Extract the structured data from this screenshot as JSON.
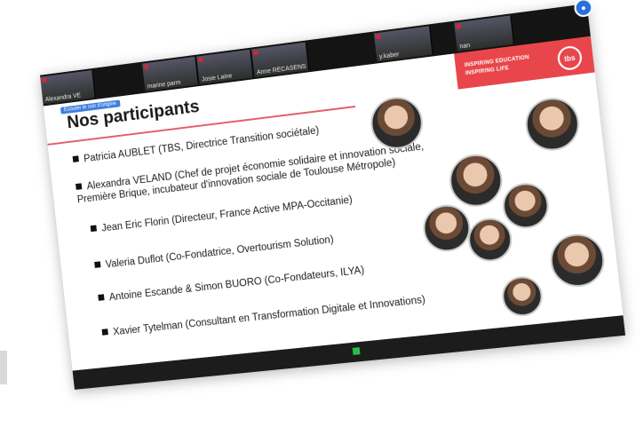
{
  "meeting": {
    "participants": [
      "Alexandra VE",
      "marine parm",
      "Josie Laine",
      "Anne RECASENS",
      "y.kaber",
      "nan"
    ]
  },
  "tooltip": "Écouter le son d'origine",
  "brand": {
    "line1": "INSPIRING EDUCATION",
    "line2": "INSPIRING LIFE",
    "logo": "tbs"
  },
  "slide": {
    "title": "Nos participants",
    "items": [
      "Patricia AUBLET (TBS, Directrice Transition sociétale)",
      "Alexandra VELAND (Chef de projet économie solidaire et innovation sociale,",
      "Première Brique, incubateur d'innovation sociale de Toulouse Métropole)",
      "Jean Eric Florin (Directeur, France Active MPA-Occitanie)",
      "Valeria Duflot (Co-Fondatrice, Overtourism Solution)",
      "Antoine Escande & Simon BUORO (Co-Fondateurs, ILYA)",
      "Xavier Tytelman (Consultant en Transformation Digitale et Innovations)"
    ]
  },
  "colors": {
    "accent": "#e35f6a",
    "brand_red": "#e8464b",
    "mic_blue": "#2a6fdc"
  }
}
